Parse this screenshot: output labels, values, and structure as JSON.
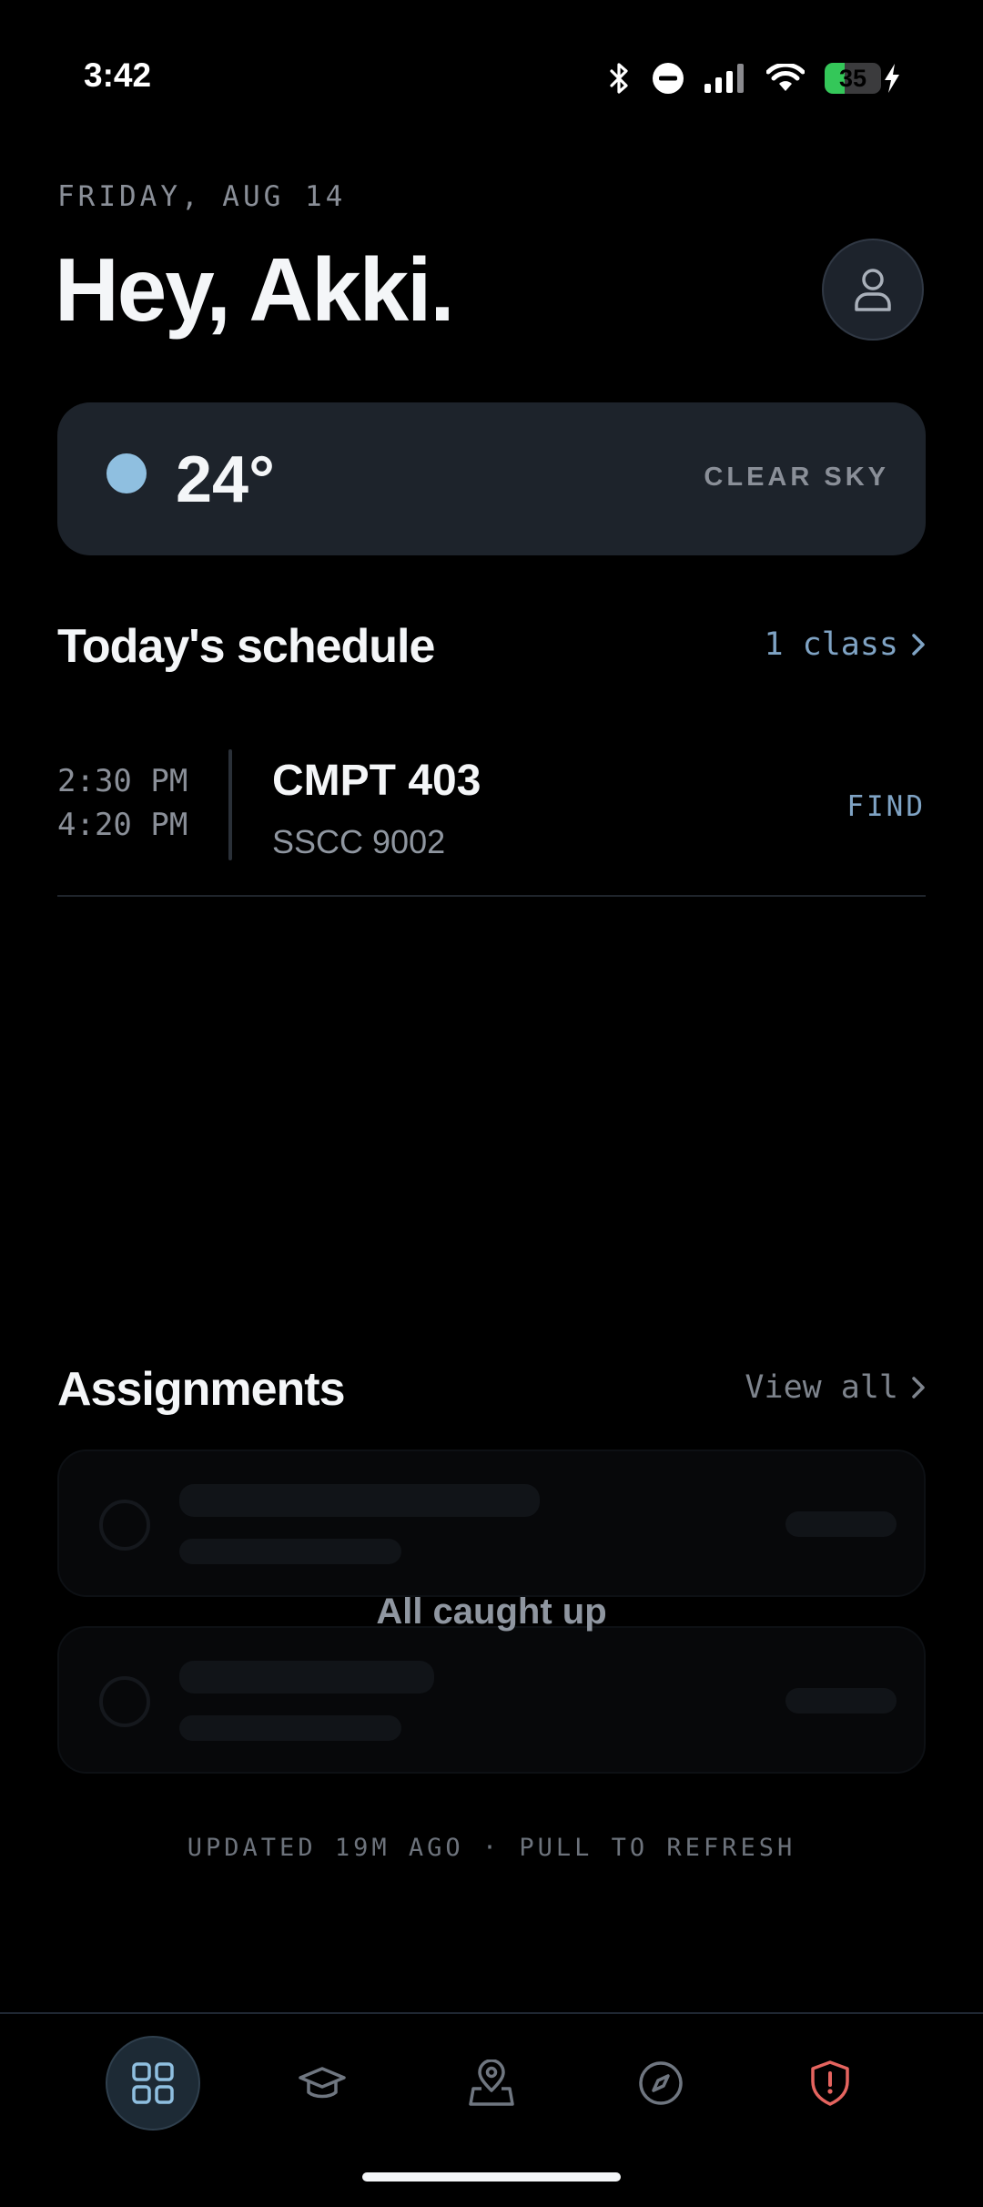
{
  "status_bar": {
    "time": "3:42",
    "battery_level": "35",
    "battery_fraction": 0.35,
    "icons": [
      "bluetooth-icon",
      "do-not-disturb-icon",
      "cellular-signal-icon",
      "wifi-icon",
      "battery-icon",
      "charging-bolt-icon"
    ]
  },
  "header": {
    "date": "FRIDAY, AUG 14",
    "greeting": "Hey, Akki.",
    "avatar_icon": "user-icon"
  },
  "weather": {
    "temperature": "24°",
    "condition": "CLEAR SKY",
    "dot_color": "#8fbfe0"
  },
  "schedule": {
    "title": "Today's schedule",
    "count_label": "1 class",
    "classes": [
      {
        "start": "2:30 PM",
        "end": "4:20 PM",
        "name": "CMPT 403",
        "room": "SSCC 9002",
        "action": "FIND"
      }
    ]
  },
  "assignments": {
    "title": "Assignments",
    "view_all": "View all",
    "empty_message": "All caught up"
  },
  "footer": {
    "updated": "UPDATED 19M AGO · PULL TO REFRESH"
  },
  "tab_bar": {
    "tabs": [
      {
        "icon": "grid-dashboard-icon",
        "active": true
      },
      {
        "icon": "graduation-cap-icon",
        "active": false
      },
      {
        "icon": "map-pin-icon",
        "active": false
      },
      {
        "icon": "compass-icon",
        "active": false
      },
      {
        "icon": "shield-alert-icon",
        "active": false
      }
    ]
  },
  "colors": {
    "accent": "#7fa3c4",
    "alert": "#e5645f",
    "background": "#000000",
    "card": "#1d232b"
  }
}
